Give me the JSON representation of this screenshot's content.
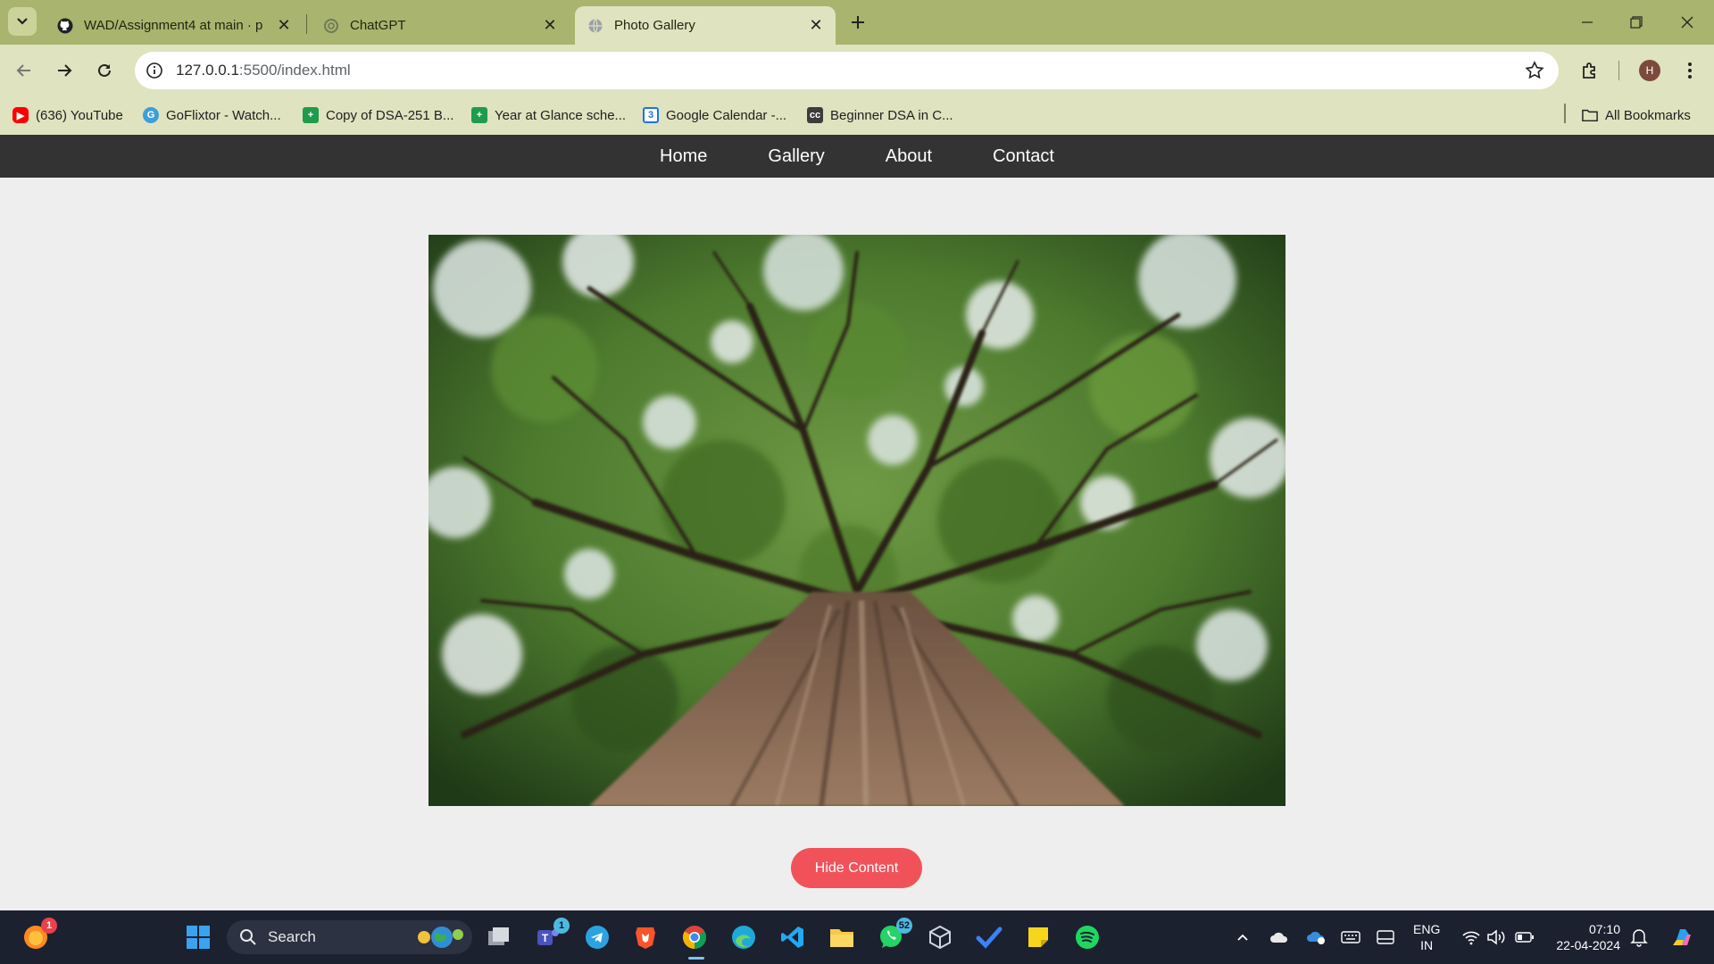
{
  "browser": {
    "tabs": [
      {
        "title": "WAD/Assignment4 at main · p",
        "favicon": "github-icon",
        "active": false
      },
      {
        "title": "ChatGPT",
        "favicon": "chatgpt-icon",
        "active": false
      },
      {
        "title": "Photo Gallery",
        "favicon": "globe-icon",
        "active": true
      }
    ],
    "url": {
      "host": "127.0.0.1",
      "path": ":5500/index.html"
    },
    "profile_initial": "H",
    "bookmarks": [
      {
        "label": "(636) YouTube",
        "icon": "youtube-icon"
      },
      {
        "label": "GoFlixtor - Watch...",
        "icon": "goflixtor-icon"
      },
      {
        "label": "Copy of DSA-251 B...",
        "icon": "sheets-icon"
      },
      {
        "label": "Year at Glance sche...",
        "icon": "sheets-icon"
      },
      {
        "label": "Google Calendar -...",
        "icon": "calendar-icon"
      },
      {
        "label": "Beginner DSA in C...",
        "icon": "cc-icon"
      }
    ],
    "all_bookmarks": "All Bookmarks"
  },
  "site": {
    "nav": [
      "Home",
      "Gallery",
      "About",
      "Contact"
    ],
    "image_alt": "",
    "button": "Hide Content"
  },
  "taskbar": {
    "search": "Search",
    "teams_badge": "1",
    "whatsapp_badge": "52",
    "notif_badge": "1",
    "lang_line1": "ENG",
    "lang_line2": "IN",
    "time": "07:10",
    "date": "22-04-2024"
  },
  "colors": {
    "tabstrip": "#a9b46e",
    "toolbar": "#dfe3bf",
    "navbar": "#333333",
    "button": "#f1525a",
    "taskbar": "#1c2130"
  }
}
